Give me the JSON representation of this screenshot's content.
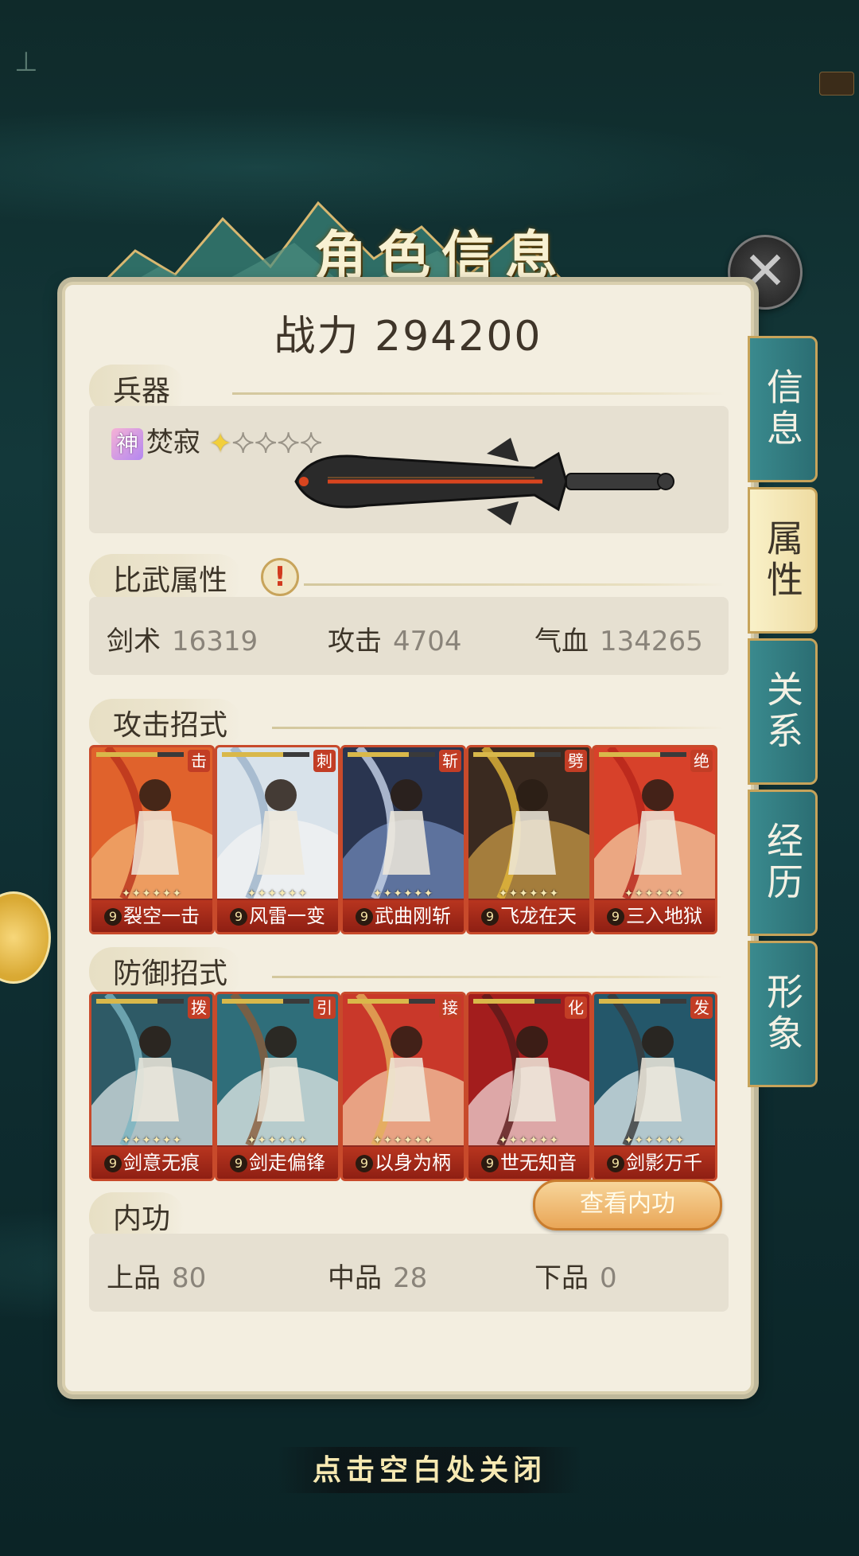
{
  "title": "角色信息",
  "power": {
    "label": "战力",
    "value": "294200"
  },
  "weapon": {
    "section": "兵器",
    "badge": "神",
    "name": "焚寂",
    "stars_total": 5,
    "stars_filled": 1
  },
  "duel_attrs": {
    "section": "比武属性",
    "alert": "!",
    "items": [
      {
        "label": "剑术",
        "value": "16319"
      },
      {
        "label": "攻击",
        "value": "4704"
      },
      {
        "label": "气血",
        "value": "134265"
      }
    ]
  },
  "attack_skills": {
    "section": "攻击招式",
    "cards": [
      {
        "tag": "击",
        "level": "9",
        "name": "裂空一击",
        "stars": "✦✦✦✦✦✦"
      },
      {
        "tag": "刺",
        "level": "9",
        "name": "风雷一变",
        "stars": "✦✦✦✦✦✦"
      },
      {
        "tag": "斩",
        "level": "9",
        "name": "武曲刚斩",
        "stars": "✦✦✦✦✦✦"
      },
      {
        "tag": "劈",
        "level": "9",
        "name": "飞龙在天",
        "stars": "✦✦✦✦✦✦"
      },
      {
        "tag": "绝",
        "level": "9",
        "name": "三入地狱",
        "stars": "✦✦✦✦✦✦"
      }
    ]
  },
  "defense_skills": {
    "section": "防御招式",
    "cards": [
      {
        "tag": "拨",
        "level": "9",
        "name": "剑意无痕",
        "stars": "✦✦✦✦✦✦"
      },
      {
        "tag": "引",
        "level": "9",
        "name": "剑走偏锋",
        "stars": "✦✦✦✦✦✦"
      },
      {
        "tag": "接",
        "level": "9",
        "name": "以身为柄",
        "stars": "✦✦✦✦✦✦"
      },
      {
        "tag": "化",
        "level": "9",
        "name": "世无知音",
        "stars": "✦✦✦✦✦✦"
      },
      {
        "tag": "发",
        "level": "9",
        "name": "剑影万千",
        "stars": "✦✦✦✦✦✦"
      }
    ]
  },
  "neigong": {
    "section": "内功",
    "button": "查看内功",
    "items": [
      {
        "label": "上品",
        "value": "80"
      },
      {
        "label": "中品",
        "value": "28"
      },
      {
        "label": "下品",
        "value": "0"
      }
    ]
  },
  "tabs": [
    {
      "label": "信息",
      "active": false
    },
    {
      "label": "属性",
      "active": true
    },
    {
      "label": "关系",
      "active": false
    },
    {
      "label": "经历",
      "active": false
    },
    {
      "label": "形象",
      "active": false
    }
  ],
  "close_hint": "点击空白处关闭",
  "colors": {
    "accent": "#c7a35a",
    "tab": "#3a8a8e",
    "card": "#b8351f"
  }
}
